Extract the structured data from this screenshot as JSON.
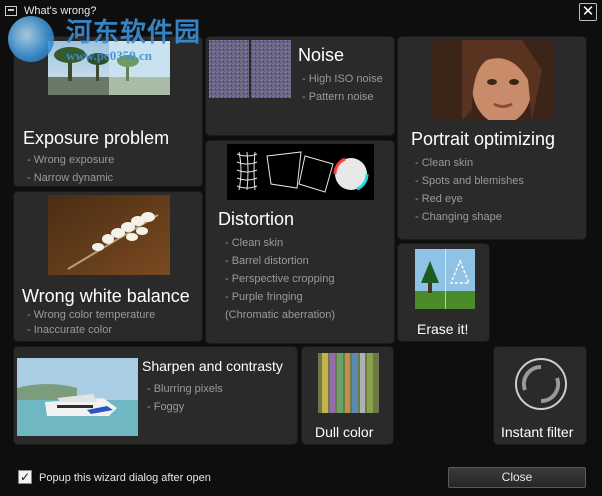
{
  "window": {
    "title": "What's wrong?",
    "close_symbol": "✕"
  },
  "watermark": {
    "text": "河东软件园",
    "url": "www.pc0359.cn"
  },
  "tiles": {
    "exposure": {
      "title": "Exposure problem",
      "items": [
        "- Wrong exposure",
        "- Narrow dynamic"
      ]
    },
    "noise": {
      "title": "Noise",
      "items": [
        "- High ISO noise",
        "- Pattern noise"
      ]
    },
    "portrait": {
      "title": "Portrait optimizing",
      "items": [
        "- Clean skin",
        "- Spots and blemishes",
        "- Red eye",
        "- Changing shape"
      ]
    },
    "distortion": {
      "title": "Distortion",
      "items": [
        "- Clean skin",
        "- Barrel distortion",
        "- Perspective cropping",
        "- Purple fringing",
        "(Chromatic aberration)"
      ]
    },
    "white_balance": {
      "title": "Wrong white balance",
      "items": [
        "- Wrong color temperature",
        "- Inaccurate color"
      ]
    },
    "erase": {
      "title": "Erase it!"
    },
    "sharpen": {
      "title": "Sharpen and contrasty",
      "items": [
        "- Blurring pixels",
        "- Foggy"
      ]
    },
    "dull": {
      "title": "Dull color"
    },
    "instant": {
      "title": "Instant filter"
    }
  },
  "footer": {
    "checkbox_label": "Popup this wizard dialog after open",
    "checkbox_checked": true,
    "check_symbol": "✓",
    "close_label": "Close"
  }
}
